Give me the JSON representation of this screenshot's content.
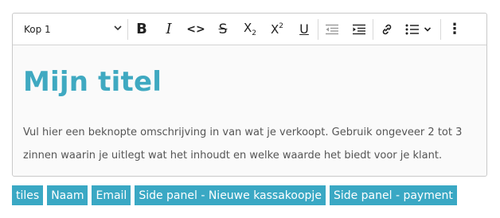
{
  "editor": {
    "heading_select": "Kop 1",
    "title": "Mijn titel",
    "body": "Vul hier een beknopte omschrijving in van wat je verkoopt. Gebruik ongeveer 2 tot 3 zinnen waarin je uitlegt wat het inhoudt en welke waarde het biedt voor je klant."
  },
  "toolbar": {
    "bold": "B",
    "italic": "I",
    "code": "<>",
    "strike": "S",
    "subscript": {
      "base": "X",
      "mark": "2"
    },
    "superscript": {
      "base": "X",
      "mark": "2"
    },
    "underline": "U",
    "more": "⋮"
  },
  "tags": [
    {
      "label": "tiles"
    },
    {
      "label": "Naam"
    },
    {
      "label": "Email"
    },
    {
      "label": "Side panel - Nieuwe kassakoopje"
    },
    {
      "label": "Side panel - payment"
    }
  ],
  "colors": {
    "accent": "#3fa9c1",
    "tag_bg": "#3aa8c4",
    "text": "#555555"
  }
}
